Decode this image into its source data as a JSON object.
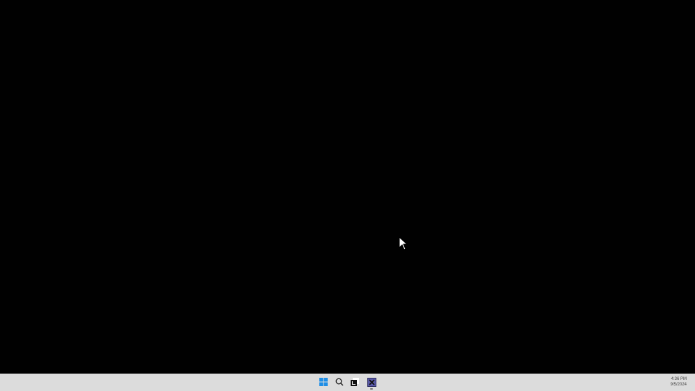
{
  "taskbar": {
    "icons": [
      "start-icon",
      "search-icon",
      "terminal-app-icon",
      "x-app-icon"
    ],
    "clock": {
      "time": "4:36 PM",
      "date": "9/5/2024"
    }
  },
  "colors": {
    "start_blue": "#1e8ee6",
    "x_app_bg": "#5a5aa8"
  }
}
